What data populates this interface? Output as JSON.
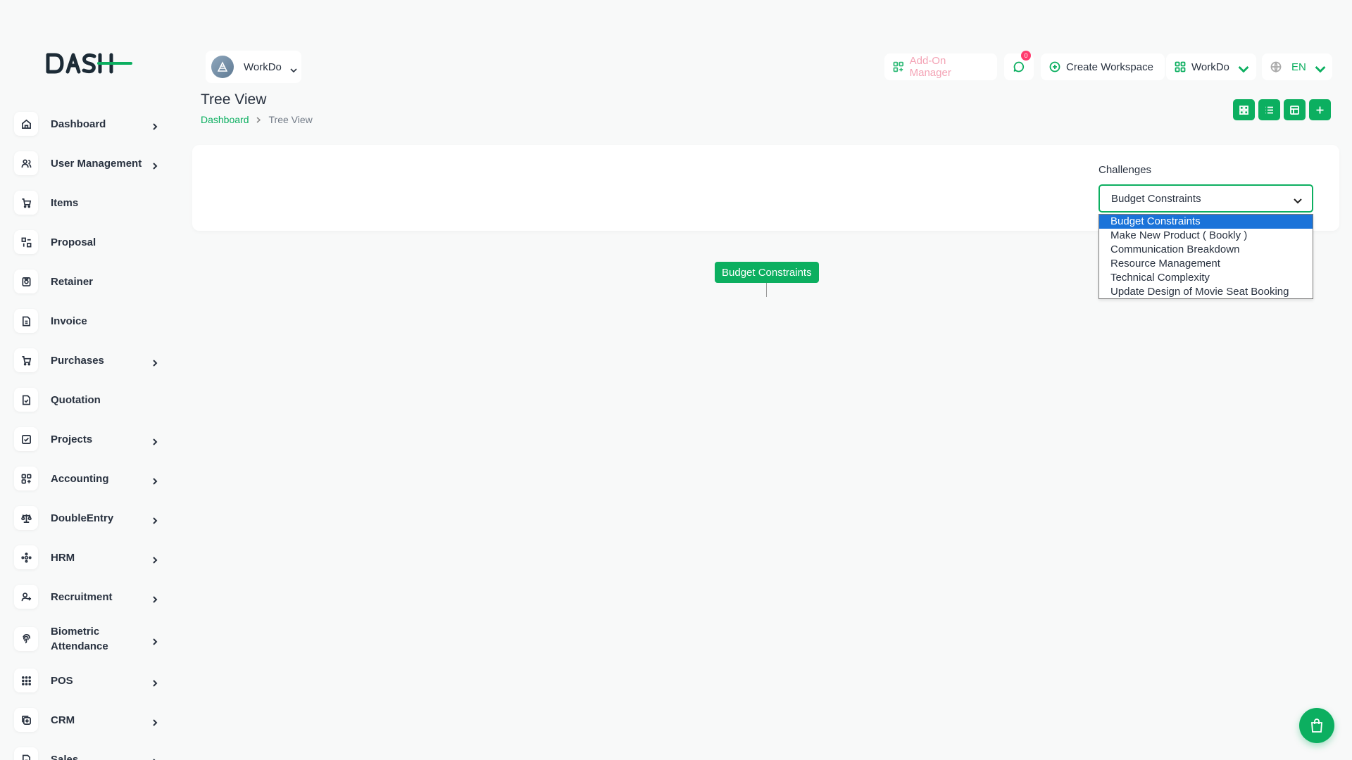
{
  "app": {
    "logo_text": "DASH",
    "accent_color": "#0CAF60"
  },
  "sidebar": {
    "items": [
      {
        "label": "Dashboard",
        "icon": "home-icon",
        "has_children": true
      },
      {
        "label": "User Management",
        "icon": "users-icon",
        "has_children": true
      },
      {
        "label": "Items",
        "icon": "cart-icon",
        "has_children": false
      },
      {
        "label": "Proposal",
        "icon": "proposal-icon",
        "has_children": false
      },
      {
        "label": "Retainer",
        "icon": "retainer-icon",
        "has_children": false
      },
      {
        "label": "Invoice",
        "icon": "file-icon",
        "has_children": false
      },
      {
        "label": "Purchases",
        "icon": "cart-icon",
        "has_children": true
      },
      {
        "label": "Quotation",
        "icon": "file-check-icon",
        "has_children": false
      },
      {
        "label": "Projects",
        "icon": "checkbox-icon",
        "has_children": true
      },
      {
        "label": "Accounting",
        "icon": "apps-icon",
        "has_children": true
      },
      {
        "label": "DoubleEntry",
        "icon": "scale-icon",
        "has_children": true
      },
      {
        "label": "HRM",
        "icon": "hrm-icon",
        "has_children": true
      },
      {
        "label": "Recruitment",
        "icon": "user-plus-icon",
        "has_children": true
      },
      {
        "label": "Biometric Attendance",
        "icon": "fingerprint-icon",
        "has_children": true
      },
      {
        "label": "POS",
        "icon": "grid-dots-icon",
        "has_children": true
      },
      {
        "label": "CRM",
        "icon": "crm-icon",
        "has_children": true
      },
      {
        "label": "Sales",
        "icon": "sales-icon",
        "has_children": true
      }
    ]
  },
  "header": {
    "workspace": "WorkDo",
    "addon_manager": "Add-On Manager",
    "message_count": "0",
    "create_workspace": "Create Workspace",
    "workspace_menu": "WorkDo",
    "language": "EN"
  },
  "page": {
    "title": "Tree View",
    "breadcrumb": {
      "home": "Dashboard",
      "current": "Tree View"
    }
  },
  "filter": {
    "label": "Challenges",
    "selected": "Budget Constraints",
    "options": [
      "Budget Constraints",
      "Make New Product ( Bookly )",
      "Communication Breakdown",
      "Resource Management",
      "Technical Complexity",
      "Update Design of Movie Seat Booking"
    ]
  },
  "tree": {
    "root_node": "Budget Constraints"
  }
}
